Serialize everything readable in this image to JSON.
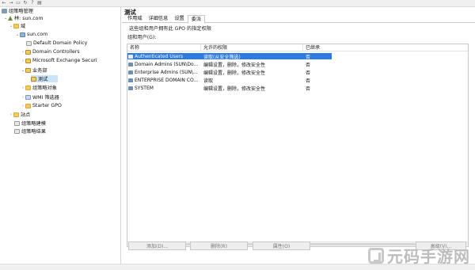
{
  "toolbar": {
    "buttons": [
      {
        "icon": "back-arrow-icon",
        "glyph": "←"
      },
      {
        "icon": "forward-arrow-icon",
        "glyph": "→"
      },
      {
        "icon": "folder-icon",
        "glyph": "▭"
      },
      {
        "icon": "refresh-icon",
        "glyph": "↻"
      },
      {
        "icon": "help-icon",
        "glyph": "?"
      },
      {
        "icon": "view-icon",
        "glyph": "▤"
      }
    ]
  },
  "tree": {
    "root": "组策略管理",
    "forest": "林: sun.com",
    "domains_folder": "域",
    "domain": "sun.com",
    "default_policy": "Default Domain Policy",
    "domain_controllers": "Domain Controllers",
    "exchange": "Microsoft Exchange Securi",
    "ou_business": "业务部",
    "ou_test": "测试",
    "gpo_objects": "组策略对象",
    "wmi_filters": "WMI 筛选器",
    "starter_gpo": "Starter GPO",
    "sites": "站点",
    "modeling": "组策略建模",
    "results": "组策略结果"
  },
  "pane": {
    "title": "测试",
    "tabs": [
      "作用域",
      "详细信息",
      "设置",
      "委派"
    ],
    "active_tab_index": 3,
    "description": "这些组和用户拥有此 GPO 的指定权限",
    "groups_label": "组和用户(G):",
    "columns": [
      "名称",
      "允许的权限",
      "已继承"
    ],
    "rows": [
      {
        "name": "Authenticated Users",
        "permission": "读取(从安全筛选)",
        "inherited": "否",
        "selected": true
      },
      {
        "name": "Domain Admins (SUN\\Do...",
        "permission": "编辑设置，删除，修改安全性",
        "inherited": "否",
        "selected": false
      },
      {
        "name": "Enterprise Admins (SUN\\...",
        "permission": "编辑设置，删除，修改安全性",
        "inherited": "否",
        "selected": false
      },
      {
        "name": "ENTERPRISE DOMAIN CO...",
        "permission": "读取",
        "inherited": "否",
        "selected": false
      },
      {
        "name": "SYSTEM",
        "permission": "编辑设置，删除，修改安全性",
        "inherited": "否",
        "selected": false
      }
    ],
    "buttons": {
      "add": "添加(D)...",
      "remove": "删除(R)",
      "properties": "属性(O)",
      "advanced": "高级(V)..."
    }
  },
  "watermark": {
    "text": "元码手游网"
  }
}
